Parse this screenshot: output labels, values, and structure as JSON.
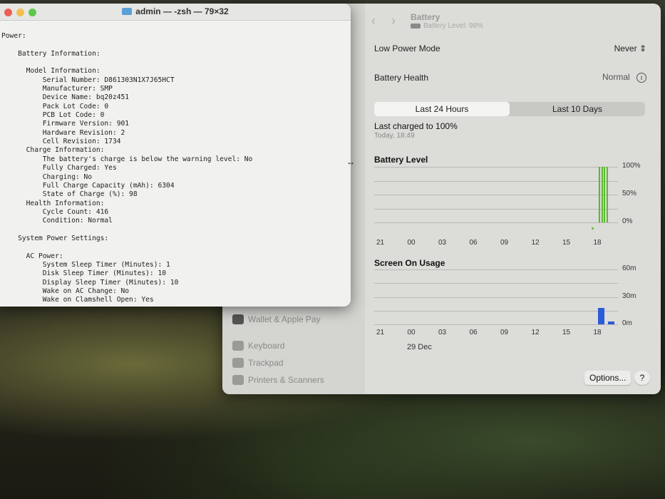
{
  "terminal": {
    "title": "admin — -zsh — 79×32",
    "lines": [
      "Power:",
      "",
      "    Battery Information:",
      "",
      "      Model Information:",
      "          Serial Number: D861303N1X7J65HCT",
      "          Manufacturer: SMP",
      "          Device Name: bq20z451",
      "          Pack Lot Code: 0",
      "          PCB Lot Code: 0",
      "          Firmware Version: 901",
      "          Hardware Revision: 2",
      "          Cell Revision: 1734",
      "      Charge Information:",
      "          The battery's charge is below the warning level: No",
      "          Fully Charged: Yes",
      "          Charging: No",
      "          Full Charge Capacity (mAh): 6304",
      "          State of Charge (%): 98",
      "      Health Information:",
      "          Cycle Count: 416",
      "          Condition: Normal",
      "",
      "    System Power Settings:",
      "",
      "      AC Power:",
      "          System Sleep Timer (Minutes): 1",
      "          Disk Sleep Timer (Minutes): 10",
      "          Display Sleep Timer (Minutes): 10",
      "          Wake on AC Change: No",
      "          Wake on Clamshell Open: Yes"
    ]
  },
  "sidebar": {
    "items": [
      {
        "label": "Wallet & Apple Pay"
      },
      {
        "label": "Keyboard"
      },
      {
        "label": "Trackpad"
      },
      {
        "label": "Printers & Scanners"
      }
    ]
  },
  "header": {
    "title": "Battery",
    "subtitle": "Battery Level: 98%"
  },
  "low_power": {
    "label": "Low Power Mode",
    "value": "Never"
  },
  "health": {
    "label": "Battery Health",
    "value": "Normal"
  },
  "tabs": [
    {
      "label": "Last 24 Hours",
      "selected": true
    },
    {
      "label": "Last 10 Days",
      "selected": false
    }
  ],
  "last_charged": {
    "label": "Last charged to 100%",
    "time": "Today, 18:49"
  },
  "chart_data": [
    {
      "type": "bar",
      "title": "Battery Level",
      "categories": [
        "21",
        "00",
        "03",
        "06",
        "09",
        "12",
        "15",
        "18"
      ],
      "ylabels": [
        "100%",
        "50%",
        "0%"
      ],
      "ylim": [
        0,
        100
      ],
      "x_hours": [
        18.1,
        18.35,
        18.6,
        18.85
      ],
      "values": [
        100,
        100,
        100,
        100
      ],
      "color": "#5cb82e"
    },
    {
      "type": "bar",
      "title": "Screen On Usage",
      "categories": [
        "21",
        "00",
        "03",
        "06",
        "09",
        "12",
        "15",
        "18"
      ],
      "date_label": "29 Dec",
      "ylabels": [
        "60m",
        "30m",
        "0m"
      ],
      "ylim": [
        0,
        60
      ],
      "x_hours": [
        18,
        19
      ],
      "values": [
        18,
        3
      ],
      "color": "#2a5bd7"
    }
  ],
  "buttons": {
    "options": "Options...",
    "help": "?"
  }
}
